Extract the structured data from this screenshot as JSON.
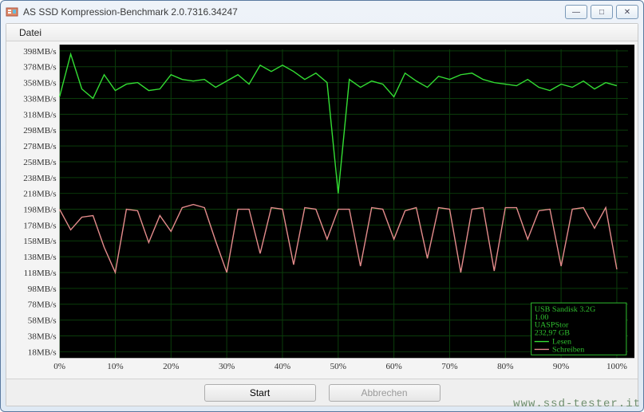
{
  "window": {
    "title": "AS SSD Kompression-Benchmark 2.0.7316.34247",
    "min_label": "—",
    "max_label": "□",
    "close_label": "✕"
  },
  "menu": {
    "datei": "Datei"
  },
  "buttons": {
    "start": "Start",
    "abort": "Abbrechen"
  },
  "watermark": "www.ssd-tester.it",
  "legend": {
    "device_line1": "USB  Sandisk 3.2G",
    "device_line2": "1.00",
    "device_line3": "UASPStor",
    "device_line4": "232,97 GB",
    "read": "Lesen",
    "write": "Schreiben"
  },
  "chart_data": {
    "type": "line",
    "xlabel": "",
    "ylabel": "",
    "y_ticks": [
      18,
      38,
      58,
      78,
      98,
      118,
      138,
      158,
      178,
      198,
      218,
      238,
      258,
      278,
      298,
      318,
      338,
      358,
      378,
      398
    ],
    "y_tick_unit": "MB/s",
    "x_ticks": [
      0,
      10,
      20,
      30,
      40,
      50,
      60,
      70,
      80,
      90,
      100
    ],
    "x_tick_unit": "%",
    "ylim": [
      10,
      400
    ],
    "xlim": [
      0,
      102
    ],
    "series": [
      {
        "name": "Lesen",
        "color": "#33dd33",
        "x": [
          0,
          2,
          4,
          6,
          8,
          10,
          12,
          14,
          16,
          18,
          20,
          22,
          24,
          26,
          28,
          30,
          32,
          34,
          36,
          38,
          40,
          42,
          44,
          46,
          48,
          50,
          52,
          54,
          56,
          58,
          60,
          62,
          64,
          66,
          68,
          70,
          72,
          74,
          76,
          78,
          80,
          82,
          84,
          86,
          88,
          90,
          92,
          94,
          96,
          98,
          100
        ],
        "y": [
          340,
          394,
          350,
          338,
          368,
          348,
          356,
          358,
          348,
          350,
          368,
          362,
          360,
          362,
          352,
          360,
          368,
          356,
          380,
          372,
          380,
          372,
          362,
          370,
          358,
          218,
          362,
          352,
          360,
          356,
          340,
          370,
          360,
          352,
          366,
          362,
          368,
          370,
          362,
          358,
          356,
          354,
          362,
          352,
          348,
          356,
          352,
          360,
          350,
          358,
          354
        ]
      },
      {
        "name": "Schreiben",
        "color": "#e38b8b",
        "x": [
          0,
          2,
          4,
          6,
          8,
          10,
          12,
          14,
          16,
          18,
          20,
          22,
          24,
          26,
          28,
          30,
          32,
          34,
          36,
          38,
          40,
          42,
          44,
          46,
          48,
          50,
          52,
          54,
          56,
          58,
          60,
          62,
          64,
          66,
          68,
          70,
          72,
          74,
          76,
          78,
          80,
          82,
          84,
          86,
          88,
          90,
          92,
          94,
          96,
          98,
          100
        ],
        "y": [
          198,
          172,
          188,
          190,
          150,
          118,
          198,
          196,
          156,
          190,
          170,
          200,
          204,
          200,
          158,
          118,
          198,
          198,
          142,
          200,
          198,
          128,
          200,
          198,
          160,
          198,
          198,
          126,
          200,
          198,
          160,
          196,
          200,
          136,
          200,
          198,
          118,
          198,
          200,
          120,
          200,
          200,
          160,
          196,
          198,
          126,
          198,
          200,
          174,
          200,
          122
        ]
      }
    ]
  }
}
